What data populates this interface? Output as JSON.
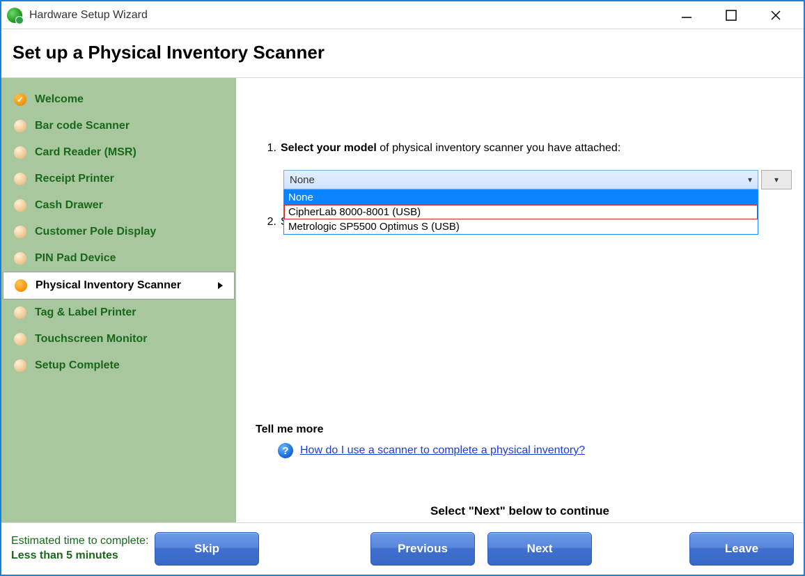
{
  "window": {
    "title": "Hardware Setup Wizard"
  },
  "page": {
    "heading": "Set up a Physical Inventory Scanner"
  },
  "sidebar": {
    "steps": [
      {
        "label": "Welcome",
        "state": "done"
      },
      {
        "label": "Bar code Scanner",
        "state": "todo"
      },
      {
        "label": "Card Reader (MSR)",
        "state": "todo"
      },
      {
        "label": "Receipt Printer",
        "state": "todo"
      },
      {
        "label": "Cash Drawer",
        "state": "todo"
      },
      {
        "label": "Customer Pole Display",
        "state": "todo"
      },
      {
        "label": "PIN Pad Device",
        "state": "todo"
      },
      {
        "label": "Physical Inventory Scanner",
        "state": "current"
      },
      {
        "label": "Tag & Label Printer",
        "state": "todo"
      },
      {
        "label": "Touchscreen Monitor",
        "state": "todo"
      },
      {
        "label": "Setup Complete",
        "state": "todo"
      }
    ]
  },
  "instructions": {
    "one_num": "1.",
    "one_strong": "Select your model",
    "one_rest": " of physical inventory scanner you have attached:",
    "two_num": "2.",
    "two_partial": "S"
  },
  "model_select": {
    "value": "None",
    "options": [
      "None",
      "CipherLab 8000-8001 (USB)",
      "Metrologic SP5500 Optimus S (USB)"
    ],
    "selected_index": 0,
    "hover_index": 1
  },
  "help": {
    "section_title": "Tell me more",
    "link_text": "How do I use a scanner to complete a physical inventory?"
  },
  "continue_hint": "Select \"Next\" below to continue",
  "footer": {
    "eta_label": "Estimated time to complete:",
    "eta_value": "Less than 5 minutes",
    "buttons": {
      "skip": "Skip",
      "prev": "Previous",
      "next": "Next",
      "leave": "Leave"
    }
  }
}
